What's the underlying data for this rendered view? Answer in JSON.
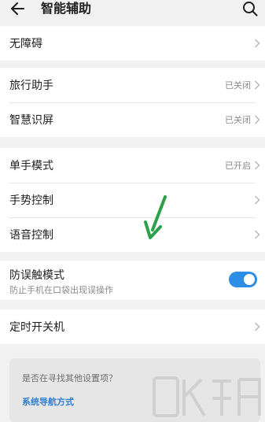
{
  "header": {
    "title": "智能辅助",
    "back_icon": "arrow-left-icon",
    "search_icon": "search-icon"
  },
  "groups": [
    {
      "items": [
        {
          "label": "无障碍",
          "value": "",
          "chevron": true
        }
      ]
    },
    {
      "items": [
        {
          "label": "旅行助手",
          "value": "已关闭",
          "chevron": true
        },
        {
          "label": "智慧识屏",
          "value": "已关闭",
          "chevron": true
        }
      ]
    },
    {
      "items": [
        {
          "label": "单手模式",
          "value": "已开启",
          "chevron": true
        },
        {
          "label": "手势控制",
          "value": "",
          "chevron": true
        },
        {
          "label": "语音控制",
          "value": "",
          "chevron": true
        }
      ]
    }
  ],
  "mistouch": {
    "title": "防误触模式",
    "subtitle": "防止手机在口袋出现误操作",
    "enabled": true
  },
  "timer": {
    "label": "定时开关机"
  },
  "suggest": {
    "question": "是否在寻找其他设置项？",
    "link": "系统导航方式"
  },
  "colors": {
    "accent": "#2c8ee4",
    "link": "#2f7fd4",
    "background": "#f1f1f1",
    "card": "#ffffff",
    "annotation_arrow": "#2aa14a"
  }
}
